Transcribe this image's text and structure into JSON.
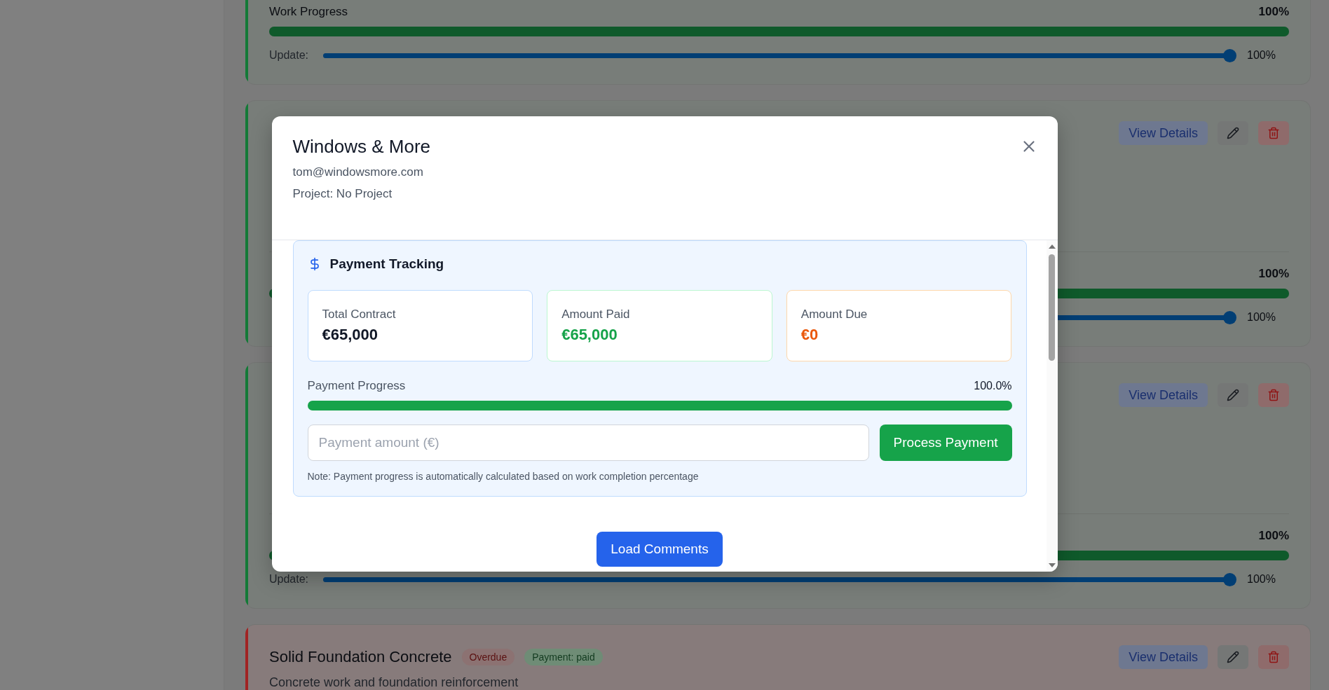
{
  "cards": [
    {
      "color": "#137a37",
      "progress_label": "Work Progress",
      "progress_value": "100%",
      "level": 1,
      "update_label": "Update:",
      "slider": {
        "level": 1
      },
      "update_value": "100%"
    },
    {
      "color": "#137a37",
      "actions": {
        "view": "View Details"
      },
      "progress_value": "100%",
      "level": 1,
      "slider": {
        "level": 1
      },
      "update_value": "100%"
    },
    {
      "color": "#137a37",
      "actions": {
        "view": "View Details"
      },
      "progress_value": "100%",
      "level": 1,
      "update_label": "Update:",
      "slider": {
        "level": 1
      },
      "update_value": "100%"
    },
    {
      "color": "#a12424",
      "actions": {
        "view": "View Details"
      },
      "title": "Solid Foundation Concrete",
      "tags": [
        {
          "label": "Overdue",
          "color": "#8c7272"
        },
        {
          "label": "Payment: paid",
          "color": "#6f8c76"
        }
      ],
      "description": "Concrete work and foundation reinforcement"
    }
  ],
  "modal": {
    "title": "Windows & More",
    "email": "tom@windowsmore.com",
    "project": "Project: No Project",
    "payment": {
      "heading": "Payment Tracking",
      "stats": [
        {
          "label": "Total Contract",
          "value": "€65,000",
          "color": "#111827"
        },
        {
          "label": "Amount Paid",
          "value": "€65,000",
          "color": "#16a34a"
        },
        {
          "label": "Amount Due",
          "value": "€0",
          "color": "#ea580c"
        }
      ],
      "progress_label": "Payment Progress",
      "progress_value": "100.0%",
      "level": 1,
      "amount_placeholder": "Payment amount (€)",
      "process_button": "Process Payment",
      "note": "Note: Payment progress is automatically calculated based on work completion percentage"
    },
    "load_comments": "Load Comments"
  }
}
